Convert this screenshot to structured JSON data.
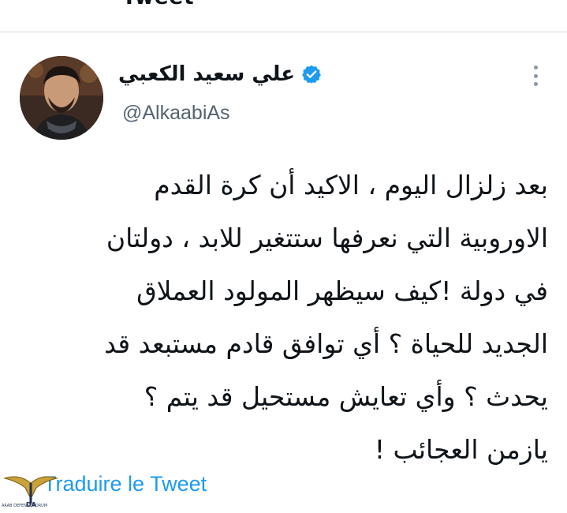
{
  "header": {
    "title_fragment": "Tweet"
  },
  "tweet": {
    "author": {
      "display_name": "علي سعيد الكعبي",
      "handle": "@AlkaabiAs",
      "verified": true
    },
    "text_lines": [
      "بعد زلزال اليوم ، الاكيد أن كرة القدم",
      "الاوروبية التي نعرفها ستتغير للابد ، دولتان",
      "في دولة !كيف سيظهر المولود العملاق",
      "الجديد للحياة ؟ أي توافق قادم مستبعد قد",
      "يحدث ؟ وأي تعايش مستحيل قد يتم ؟",
      "يازمن العجائب !"
    ],
    "translate_label": "Traduire le Tweet"
  },
  "watermark": {
    "text": "ARAB DEFENSE FORUM"
  },
  "colors": {
    "accent": "#1d9bf0",
    "secondary_text": "#536471",
    "divider": "#cfd9de"
  },
  "icons": {
    "verified": "verified-badge-icon",
    "more": "more-vertical-icon"
  }
}
